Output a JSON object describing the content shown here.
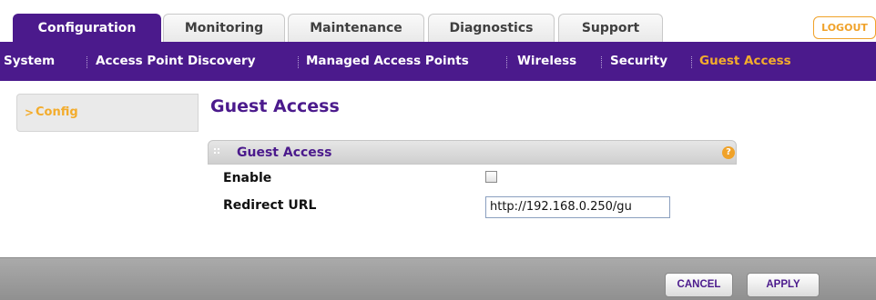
{
  "top_tabs": [
    {
      "label": "Configuration",
      "active": true
    },
    {
      "label": "Monitoring",
      "active": false
    },
    {
      "label": "Maintenance",
      "active": false
    },
    {
      "label": "Diagnostics",
      "active": false
    },
    {
      "label": "Support",
      "active": false
    }
  ],
  "logout_label": "LOGOUT",
  "sub_nav": [
    {
      "label": "System",
      "active": false
    },
    {
      "label": "Access Point Discovery",
      "active": false
    },
    {
      "label": "Managed Access Points",
      "active": false
    },
    {
      "label": "Wireless",
      "active": false
    },
    {
      "label": "Security",
      "active": false
    },
    {
      "label": "Guest Access",
      "active": true
    }
  ],
  "left_nav": {
    "arrow": ">",
    "label": "Config"
  },
  "page_title": "Guest Access",
  "panel": {
    "title": "Guest Access",
    "help_glyph": "?",
    "enable_label": "Enable",
    "enable_checked": false,
    "redirect_label": "Redirect URL",
    "redirect_value": "http://192.168.0.250/gu"
  },
  "buttons": {
    "cancel": "CANCEL",
    "apply": "APPLY"
  },
  "colors": {
    "brand_purple": "#4b1a8c",
    "accent_orange": "#f3ac2c"
  }
}
